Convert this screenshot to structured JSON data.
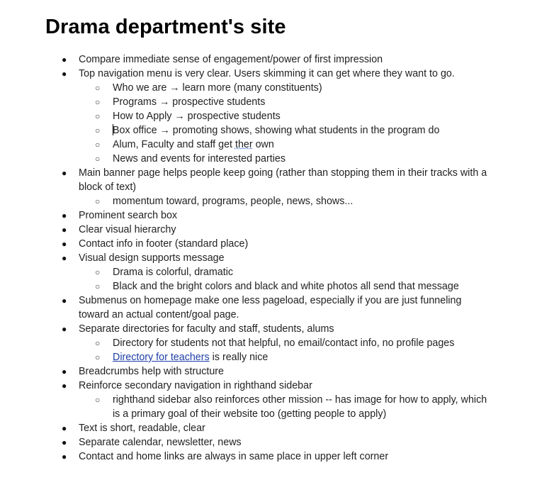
{
  "page": {
    "title": "Drama department's site"
  },
  "bullets": {
    "level1": "●",
    "level2": "○"
  },
  "items": [
    {
      "text": "Compare immediate sense of engagement/power of first impression"
    },
    {
      "text": "Top navigation menu is very clear. Users skimming it can get where they want to go."
    },
    {
      "text": "Who we are → learn more (many constituents)"
    },
    {
      "text": "Programs → prospective students"
    },
    {
      "text": "How to Apply → prospective students"
    },
    {
      "text": "Box office → promoting shows, showing what students in the program do"
    },
    {
      "text_before": "Alum, Faculty and staff get ",
      "spellcheck_word": "ther",
      "text_after": " own"
    },
    {
      "text": "News and events for interested parties"
    },
    {
      "text": "Main banner page helps people keep going (rather than stopping them in their tracks with a block of text)"
    },
    {
      "text": "momentum toward, programs, people, news, shows..."
    },
    {
      "text": "Prominent search box"
    },
    {
      "text": "Clear visual hierarchy"
    },
    {
      "text": "Contact info in footer (standard place)"
    },
    {
      "text": "Visual design supports message"
    },
    {
      "text": "Drama is colorful, dramatic"
    },
    {
      "text": "Black and the bright colors and black and white photos all send that message"
    },
    {
      "text": "Submenus on homepage make one less pageload, especially if you are just funneling toward an actual content/goal page."
    },
    {
      "text": "Separate directories for faculty and staff, students, alums"
    },
    {
      "text": "Directory for students not that helpful, no email/contact info, no profile pages"
    },
    {
      "link": "Directory for teachers",
      "text_after": " is really nice"
    },
    {
      "text": "Breadcrumbs help with structure"
    },
    {
      "text": "Reinforce secondary navigation in righthand sidebar"
    },
    {
      "text": "righthand sidebar also reinforces other mission -- has image for how to apply, which is a primary goal of their website too (getting people to apply)"
    },
    {
      "text": "Text is short, readable, clear"
    },
    {
      "text": "Separate calendar, newsletter, news"
    },
    {
      "text": "Contact and home links are always in same place in upper left corner"
    }
  ]
}
